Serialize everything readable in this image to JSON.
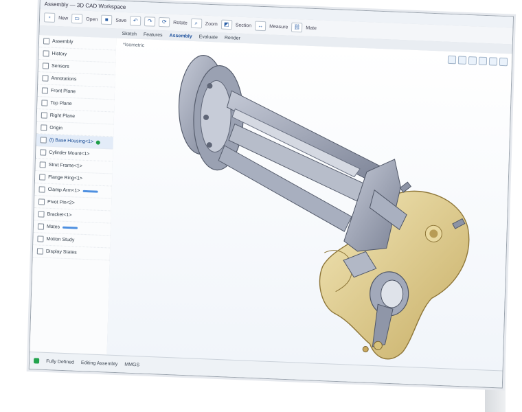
{
  "app": {
    "title": "Assembly — 3D CAD Workspace",
    "tabs": [
      "Sketch",
      "Features",
      "Assembly",
      "Evaluate",
      "Render"
    ],
    "active_tab": "Assembly"
  },
  "ribbon": {
    "buttons": [
      {
        "icon": "new-file-icon",
        "label": "New"
      },
      {
        "icon": "open-icon",
        "label": "Open"
      },
      {
        "icon": "save-icon",
        "label": "Save"
      },
      {
        "icon": "undo-icon",
        "label": "Undo"
      },
      {
        "icon": "redo-icon",
        "label": "Redo"
      },
      {
        "icon": "rotate-icon",
        "label": "Rotate"
      },
      {
        "icon": "zoom-icon",
        "label": "Zoom"
      },
      {
        "icon": "section-icon",
        "label": "Section"
      },
      {
        "icon": "measure-icon",
        "label": "Measure"
      },
      {
        "icon": "mate-icon",
        "label": "Mate"
      }
    ]
  },
  "sidebar": {
    "items": [
      {
        "label": "Assembly",
        "icon": "assembly-icon"
      },
      {
        "label": "History",
        "icon": "history-icon"
      },
      {
        "label": "Sensors",
        "icon": "sensor-icon"
      },
      {
        "label": "Annotations",
        "icon": "annotation-icon"
      },
      {
        "label": "Front Plane",
        "icon": "plane-icon"
      },
      {
        "label": "Top Plane",
        "icon": "plane-icon"
      },
      {
        "label": "Right Plane",
        "icon": "plane-icon"
      },
      {
        "label": "Origin",
        "icon": "origin-icon"
      },
      {
        "label": "(f) Base Housing<1>",
        "icon": "part-icon",
        "selected": true
      },
      {
        "label": "Cylinder Mount<1>",
        "icon": "part-icon"
      },
      {
        "label": "Strut Frame<1>",
        "icon": "part-icon"
      },
      {
        "label": "Flange Ring<1>",
        "icon": "part-icon"
      },
      {
        "label": "Clamp Arm<1>",
        "icon": "part-icon"
      },
      {
        "label": "Pivot Pin<2>",
        "icon": "part-icon"
      },
      {
        "label": "Bracket<1>",
        "icon": "part-icon"
      },
      {
        "label": "Mates",
        "icon": "mate-icon"
      },
      {
        "label": "Motion Study",
        "icon": "motion-icon"
      },
      {
        "label": "Display States",
        "icon": "display-icon"
      }
    ]
  },
  "viewport": {
    "caption": "*Isometric",
    "colors": {
      "steel": "#8f96a8",
      "steel_dark": "#5f6677",
      "brass": "#e2d08e",
      "brass_dark": "#b79c55",
      "accent": "#2b6fd6"
    }
  },
  "status": {
    "state": "Fully Defined",
    "mode": "Editing Assembly",
    "units": "MMGS"
  }
}
